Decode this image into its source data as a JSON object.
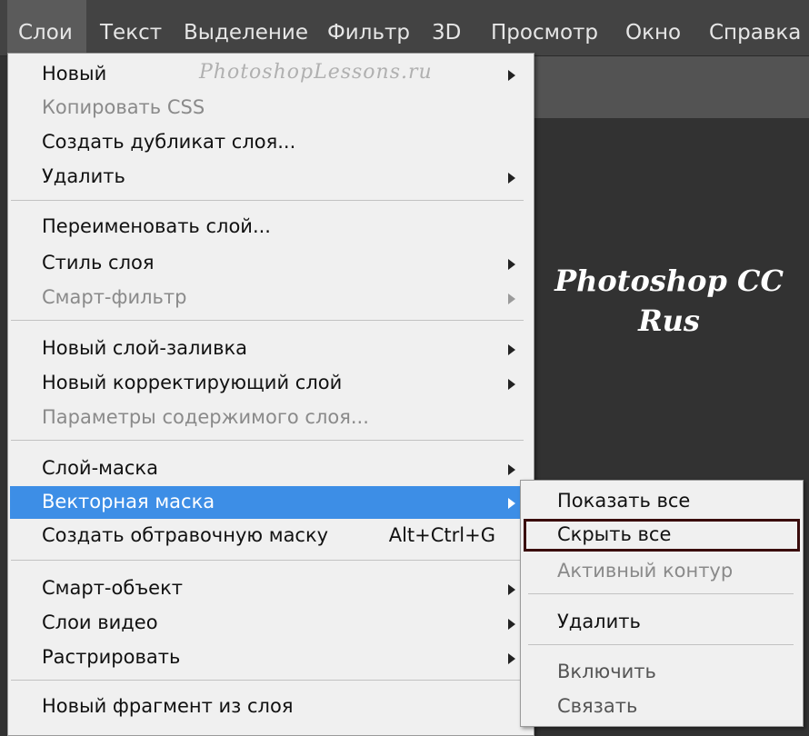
{
  "menubar": {
    "items": [
      "Слои",
      "Текст",
      "Выделение",
      "Фильтр",
      "3D",
      "Просмотр",
      "Окно",
      "Справка"
    ],
    "active": "Слои"
  },
  "canvas": {
    "line1": "Photoshop CC",
    "line2": "Rus"
  },
  "watermark": "PhotoshopLessons.ru",
  "menu": {
    "items": [
      {
        "label": "Новый",
        "submenu": true,
        "disabled": false
      },
      {
        "label": "Копировать CSS",
        "submenu": false,
        "disabled": true
      },
      {
        "label": "Создать дубликат слоя...",
        "submenu": false,
        "disabled": false
      },
      {
        "label": "Удалить",
        "submenu": true,
        "disabled": false
      },
      {
        "label": "Переименовать слой...",
        "submenu": false,
        "disabled": false
      },
      {
        "label": "Стиль слоя",
        "submenu": true,
        "disabled": false
      },
      {
        "label": "Смарт-фильтр",
        "submenu": true,
        "disabled": true
      },
      {
        "label": "Новый слой-заливка",
        "submenu": true,
        "disabled": false
      },
      {
        "label": "Новый корректирующий слой",
        "submenu": true,
        "disabled": false
      },
      {
        "label": "Параметры содержимого слоя...",
        "submenu": false,
        "disabled": true
      },
      {
        "label": "Слой-маска",
        "submenu": true,
        "disabled": false
      },
      {
        "label": "Векторная маска",
        "submenu": true,
        "disabled": false,
        "highlighted": true
      },
      {
        "label": "Создать обтравочную маску",
        "submenu": false,
        "disabled": false,
        "shortcut": "Alt+Ctrl+G"
      },
      {
        "label": "Смарт-объект",
        "submenu": true,
        "disabled": false
      },
      {
        "label": "Слои видео",
        "submenu": true,
        "disabled": false
      },
      {
        "label": "Растрировать",
        "submenu": true,
        "disabled": false
      },
      {
        "label": "Новый фрагмент из слоя",
        "submenu": false,
        "disabled": false
      }
    ]
  },
  "submenu": {
    "items": [
      {
        "label": "Показать все",
        "disabled": false
      },
      {
        "label": "Скрыть все",
        "disabled": false,
        "boxed": true
      },
      {
        "label": "Активный контур",
        "disabled": true
      },
      {
        "label": "Удалить",
        "disabled": false
      },
      {
        "label": "Включить",
        "disabled": true
      },
      {
        "label": "Связать",
        "disabled": true
      }
    ]
  },
  "colors": {
    "highlight": "#3d8ee6",
    "menu_bg": "#f0f0f0",
    "menubar_bg": "#434343"
  }
}
